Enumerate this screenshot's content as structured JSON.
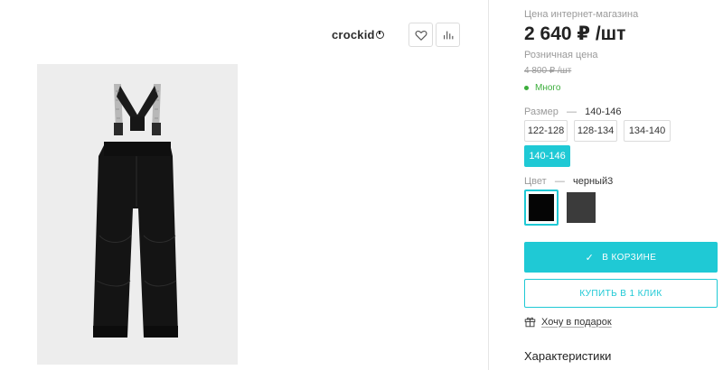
{
  "product": {
    "brand": "crockid",
    "image_alt": "Брюки на подтяжках черные"
  },
  "pricing": {
    "online_label": "Цена интернет-магазина",
    "online_price": "2 640 ₽ /шт",
    "retail_label": "Розничная цена",
    "retail_price": "4 800 ₽ /шт",
    "availability": "Много",
    "availability_color": "#3cae3c"
  },
  "size": {
    "label": "Размер",
    "selected": "140-146",
    "options": [
      "122-128",
      "128-134",
      "134-140",
      "140-146"
    ]
  },
  "color": {
    "label": "Цвет",
    "selected": "черный3",
    "swatches": [
      {
        "name": "черный3",
        "hex": "#050505"
      },
      {
        "name": "dark-grey",
        "hex": "#3b3b3b"
      }
    ]
  },
  "actions": {
    "cart_label": "В КОРЗИНЕ",
    "one_click_label": "КУПИТЬ В 1 КЛИК",
    "gift_label": "Хочу в подарок"
  },
  "sections": {
    "characteristics": "Характеристики"
  },
  "theme": {
    "accent": "#1fc9d5"
  }
}
